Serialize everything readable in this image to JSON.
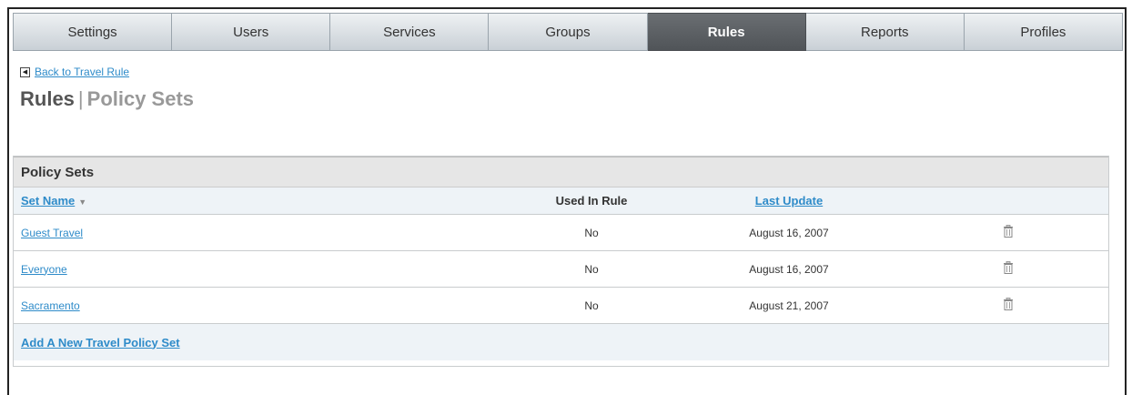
{
  "tabs": [
    {
      "label": "Settings",
      "active": false
    },
    {
      "label": "Users",
      "active": false
    },
    {
      "label": "Services",
      "active": false
    },
    {
      "label": "Groups",
      "active": false
    },
    {
      "label": "Rules",
      "active": true
    },
    {
      "label": "Reports",
      "active": false
    },
    {
      "label": "Profiles",
      "active": false
    }
  ],
  "back_link": "Back to Travel Rule",
  "title": {
    "main": "Rules",
    "separator": "|",
    "sub": "Policy Sets"
  },
  "panel": {
    "heading": "Policy Sets",
    "columns": {
      "set_name": "Set Name",
      "used_in_rule": "Used In Rule",
      "last_update": "Last Update"
    },
    "rows": [
      {
        "name": "Guest Travel",
        "used": "No",
        "date": "August 16, 2007"
      },
      {
        "name": "Everyone",
        "used": "No",
        "date": "August 16, 2007"
      },
      {
        "name": "Sacramento",
        "used": "No",
        "date": "August 21, 2007"
      }
    ],
    "add_link": "Add A New Travel Policy Set"
  },
  "colors": {
    "active_tab": "#505458",
    "link": "#2e8bc9",
    "panel_header": "#e6e6e6",
    "row_header": "#eef3f7"
  },
  "icons": {
    "back": "back-arrow-icon",
    "sort": "sort-desc-icon",
    "delete": "trash-icon"
  }
}
